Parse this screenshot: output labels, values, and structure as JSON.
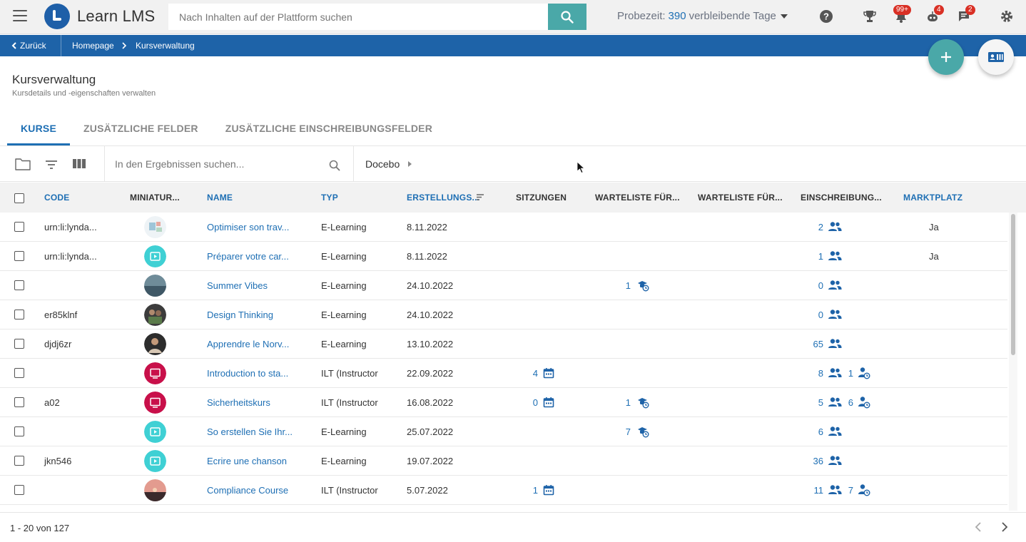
{
  "header": {
    "app_name": "Learn LMS",
    "search_placeholder": "Nach Inhalten auf der Plattform suchen",
    "trial_label": "Probezeit:",
    "trial_days": "390",
    "trial_suffix": "verbleibende Tage",
    "badges": {
      "notifications": "99+",
      "bot": "4",
      "messages": "2"
    }
  },
  "breadcrumb": {
    "back": "Zurück",
    "home": "Homepage",
    "current": "Kursverwaltung"
  },
  "page": {
    "title": "Kursverwaltung",
    "subtitle": "Kursdetails und -eigenschaften verwalten"
  },
  "tabs": [
    {
      "label": "KURSE",
      "active": true
    },
    {
      "label": "ZUSÄTZLICHE FELDER",
      "active": false
    },
    {
      "label": "ZUSÄTZLICHE EINSCHREIBUNGSFELDER",
      "active": false
    }
  ],
  "toolbar": {
    "search_placeholder": "In den Ergebnissen suchen...",
    "folder": "Docebo"
  },
  "table": {
    "columns": {
      "code": "CODE",
      "thumbnail": "MINIATUR...",
      "name": "NAME",
      "type": "TYP",
      "created": "ERSTELLUNGS...",
      "sessions": "SITZUNGEN",
      "waitlist1": "WARTELISTE FÜR...",
      "waitlist2": "WARTELISTE FÜR...",
      "enrollments": "EINSCHREIBUNG...",
      "marketplace": "MARKTPLATZ"
    },
    "rows": [
      {
        "code": "urn:li:lynda...",
        "thumb": "image",
        "name": "Optimiser son trav...",
        "type": "E-Learning",
        "created": "8.11.2022",
        "sessions": "",
        "waitlist": "",
        "enrolled": "2",
        "pending": "",
        "marketplace": "Ja"
      },
      {
        "code": "urn:li:lynda...",
        "thumb": "video",
        "name": "Préparer votre car...",
        "type": "E-Learning",
        "created": "8.11.2022",
        "sessions": "",
        "waitlist": "",
        "enrolled": "1",
        "pending": "",
        "marketplace": "Ja"
      },
      {
        "code": "",
        "thumb": "photo-sea",
        "name": "Summer Vibes",
        "type": "E-Learning",
        "created": "24.10.2022",
        "sessions": "",
        "waitlist": "1",
        "enrolled": "0",
        "pending": "",
        "marketplace": ""
      },
      {
        "code": "er85klnf",
        "thumb": "photo-people",
        "name": "Design Thinking",
        "type": "E-Learning",
        "created": "24.10.2022",
        "sessions": "",
        "waitlist": "",
        "enrolled": "0",
        "pending": "",
        "marketplace": ""
      },
      {
        "code": "djdj6zr",
        "thumb": "photo-person",
        "name": "Apprendre le Norv...",
        "type": "E-Learning",
        "created": "13.10.2022",
        "sessions": "",
        "waitlist": "",
        "enrolled": "65",
        "pending": "",
        "marketplace": ""
      },
      {
        "code": "",
        "thumb": "ilt",
        "name": "Introduction to sta...",
        "type": "ILT (Instructor",
        "created": "22.09.2022",
        "sessions": "4",
        "waitlist": "",
        "enrolled": "8",
        "pending": "1",
        "marketplace": ""
      },
      {
        "code": "a02",
        "thumb": "ilt",
        "name": "Sicherheitskurs",
        "type": "ILT (Instructor",
        "created": "16.08.2022",
        "sessions": "0",
        "waitlist": "1",
        "enrolled": "5",
        "pending": "6",
        "marketplace": ""
      },
      {
        "code": "",
        "thumb": "video",
        "name": "So erstellen Sie Ihr...",
        "type": "E-Learning",
        "created": "25.07.2022",
        "sessions": "",
        "waitlist": "7",
        "enrolled": "6",
        "pending": "",
        "marketplace": ""
      },
      {
        "code": "jkn546",
        "thumb": "video",
        "name": "Ecrire une chanson",
        "type": "E-Learning",
        "created": "19.07.2022",
        "sessions": "",
        "waitlist": "",
        "enrolled": "36",
        "pending": "",
        "marketplace": ""
      },
      {
        "code": "",
        "thumb": "photo-sunset",
        "name": "Compliance Course",
        "type": "ILT (Instructor",
        "created": "5.07.2022",
        "sessions": "1",
        "waitlist": "",
        "enrolled": "11",
        "pending": "7",
        "marketplace": ""
      }
    ]
  },
  "pagination": {
    "label": "1 - 20 von 127"
  },
  "colors": {
    "primary": "#1e63a8",
    "accent": "#4aa8a8",
    "link": "#1e6fb4",
    "badge": "#d93025",
    "ilt": "#c8104a",
    "video": "#3fd0d4"
  }
}
